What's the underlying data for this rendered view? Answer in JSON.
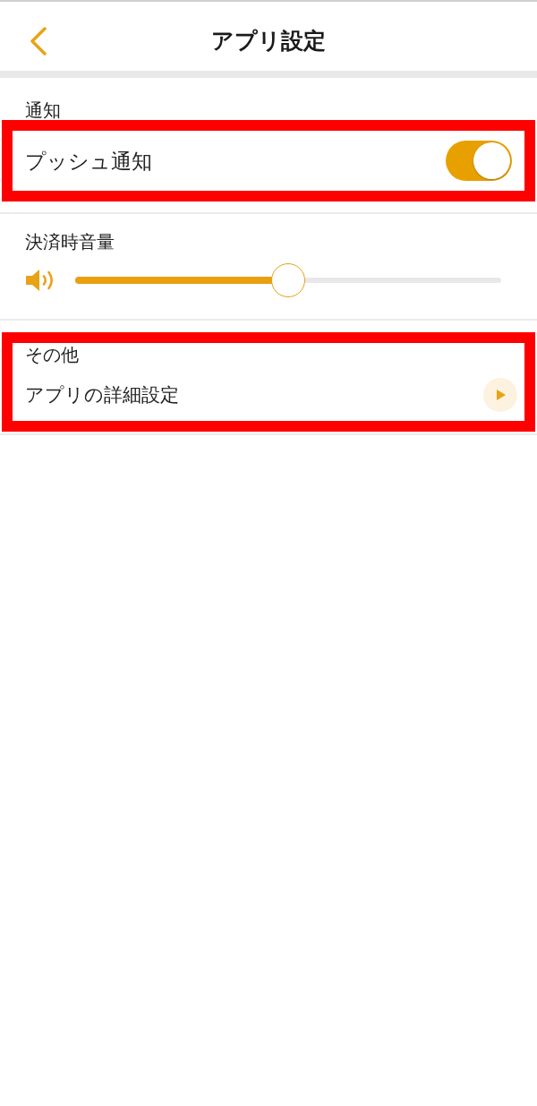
{
  "header": {
    "title": "アプリ設定"
  },
  "sections": [
    {
      "kind": "toggle",
      "title": "通知",
      "highlighted": false,
      "row": {
        "label": "プッシュ通知",
        "on": true,
        "highlighted": true
      }
    },
    {
      "kind": "slider",
      "title": "決済時音量",
      "highlighted": false,
      "level": 0.5
    },
    {
      "kind": "link",
      "title": "その他",
      "highlighted": true,
      "row": {
        "label": "アプリの詳細設定"
      }
    }
  ]
}
